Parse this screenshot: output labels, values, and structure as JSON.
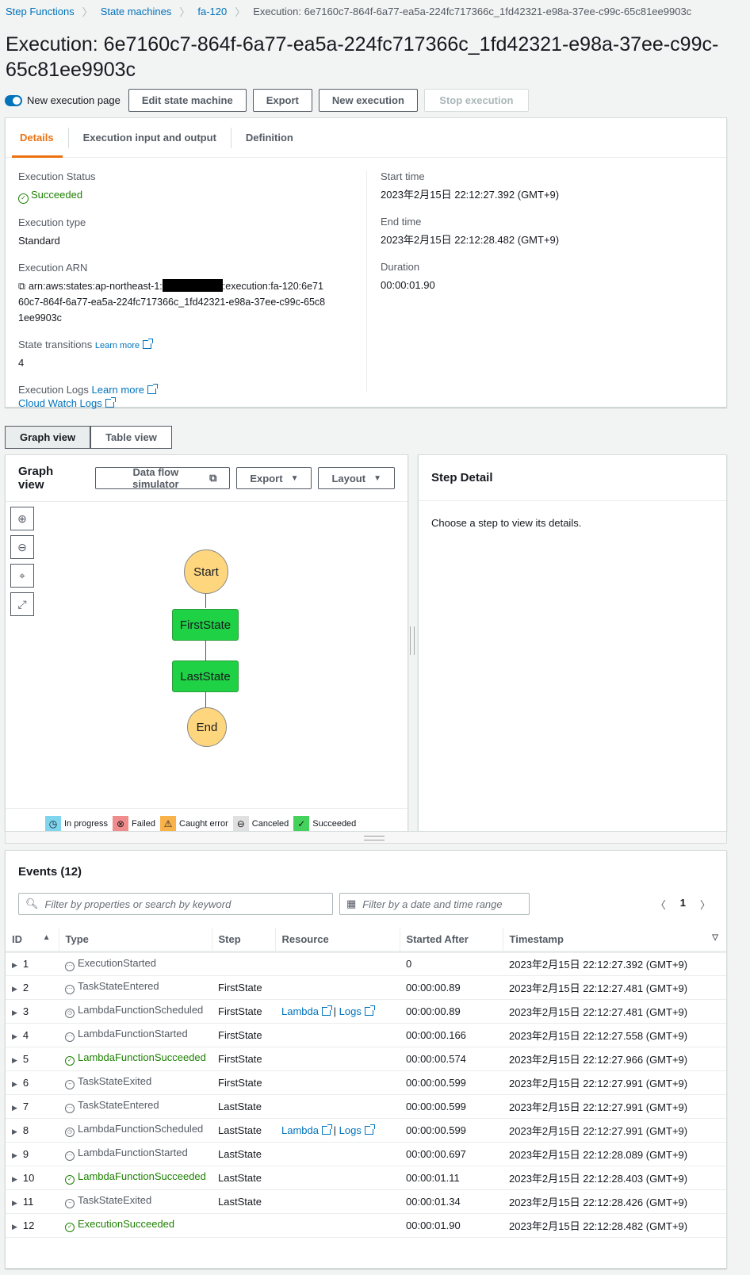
{
  "breadcrumb": [
    "Step Functions",
    "State machines",
    "fa-120",
    "Execution: 6e7160c7-864f-6a77-ea5a-224fc717366c_1fd42321-e98a-37ee-c99c-65c81ee9903c"
  ],
  "title": "Execution: 6e7160c7-864f-6a77-ea5a-224fc717366c_1fd42321-e98a-37ee-c99c-65c81ee9903c",
  "actions": {
    "toggle_label": "New execution page",
    "edit": "Edit state machine",
    "export": "Export",
    "new": "New execution",
    "stop": "Stop execution"
  },
  "tabs": [
    "Details",
    "Execution input and output",
    "Definition"
  ],
  "details": {
    "status_label": "Execution Status",
    "status": "Succeeded",
    "type_label": "Execution type",
    "type": "Standard",
    "arn_label": "Execution ARN",
    "arn_prefix": "arn:aws:states:ap-northeast-1:",
    "arn_suffix": ":execution:fa-120:6e7160c7-864f-6a77-ea5a-224fc717366c_1fd42321-e98a-37ee-c99c-65c81ee9903c",
    "transitions_label": "State transitions",
    "learn_more": "Learn more",
    "transitions": "4",
    "logs_label": "Execution Logs",
    "cloudwatch": "Cloud Watch Logs",
    "start_label": "Start time",
    "start": "2023年2月15日 22:12:27.392 (GMT+9)",
    "end_label": "End time",
    "end": "2023年2月15日 22:12:28.482 (GMT+9)",
    "duration_label": "Duration",
    "duration": "00:00:01.90"
  },
  "view_toggle": [
    "Graph view",
    "Table view"
  ],
  "graph": {
    "title": "Graph view",
    "simulator": "Data flow simulator",
    "export": "Export",
    "layout": "Layout",
    "nodes": [
      "Start",
      "FirstState",
      "LastState",
      "End"
    ],
    "legend": [
      "In progress",
      "Failed",
      "Caught error",
      "Canceled",
      "Succeeded"
    ]
  },
  "step_detail": {
    "title": "Step Detail",
    "hint": "Choose a step to view its details."
  },
  "events": {
    "title": "Events (12)",
    "search_placeholder": "Filter by properties or search by keyword",
    "date_placeholder": "Filter by a date and time range",
    "page": "1",
    "columns": [
      "ID",
      "Type",
      "Step",
      "Resource",
      "Started After",
      "Timestamp"
    ],
    "lambda": "Lambda",
    "logs": "Logs",
    "sep": "|",
    "rows": [
      {
        "id": "1",
        "type": "ExecutionStarted",
        "step": "",
        "res": false,
        "after": "0",
        "ts": "2023年2月15日 22:12:27.392 (GMT+9)",
        "kind": "dots"
      },
      {
        "id": "2",
        "type": "TaskStateEntered",
        "step": "FirstState",
        "res": false,
        "after": "00:00:00.89",
        "ts": "2023年2月15日 22:12:27.481 (GMT+9)",
        "kind": "dots"
      },
      {
        "id": "3",
        "type": "LambdaFunctionScheduled",
        "step": "FirstState",
        "res": true,
        "after": "00:00:00.89",
        "ts": "2023年2月15日 22:12:27.481 (GMT+9)",
        "kind": "clock"
      },
      {
        "id": "4",
        "type": "LambdaFunctionStarted",
        "step": "FirstState",
        "res": false,
        "after": "00:00:00.166",
        "ts": "2023年2月15日 22:12:27.558 (GMT+9)",
        "kind": "dots"
      },
      {
        "id": "5",
        "type": "LambdaFunctionSucceeded",
        "step": "FirstState",
        "res": false,
        "after": "00:00:00.574",
        "ts": "2023年2月15日 22:12:27.966 (GMT+9)",
        "kind": "check"
      },
      {
        "id": "6",
        "type": "TaskStateExited",
        "step": "FirstState",
        "res": false,
        "after": "00:00:00.599",
        "ts": "2023年2月15日 22:12:27.991 (GMT+9)",
        "kind": "minus"
      },
      {
        "id": "7",
        "type": "TaskStateEntered",
        "step": "LastState",
        "res": false,
        "after": "00:00:00.599",
        "ts": "2023年2月15日 22:12:27.991 (GMT+9)",
        "kind": "dots"
      },
      {
        "id": "8",
        "type": "LambdaFunctionScheduled",
        "step": "LastState",
        "res": true,
        "after": "00:00:00.599",
        "ts": "2023年2月15日 22:12:27.991 (GMT+9)",
        "kind": "clock"
      },
      {
        "id": "9",
        "type": "LambdaFunctionStarted",
        "step": "LastState",
        "res": false,
        "after": "00:00:00.697",
        "ts": "2023年2月15日 22:12:28.089 (GMT+9)",
        "kind": "dots"
      },
      {
        "id": "10",
        "type": "LambdaFunctionSucceeded",
        "step": "LastState",
        "res": false,
        "after": "00:00:01.11",
        "ts": "2023年2月15日 22:12:28.403 (GMT+9)",
        "kind": "check"
      },
      {
        "id": "11",
        "type": "TaskStateExited",
        "step": "LastState",
        "res": false,
        "after": "00:00:01.34",
        "ts": "2023年2月15日 22:12:28.426 (GMT+9)",
        "kind": "minus"
      },
      {
        "id": "12",
        "type": "ExecutionSucceeded",
        "step": "",
        "res": false,
        "after": "00:00:01.90",
        "ts": "2023年2月15日 22:12:28.482 (GMT+9)",
        "kind": "check"
      }
    ]
  },
  "colors": {
    "accent": "#ec7211",
    "link": "#0073bb",
    "success": "#1d8102",
    "node_task": "#1fd145",
    "node_terminal": "#fed67e"
  }
}
